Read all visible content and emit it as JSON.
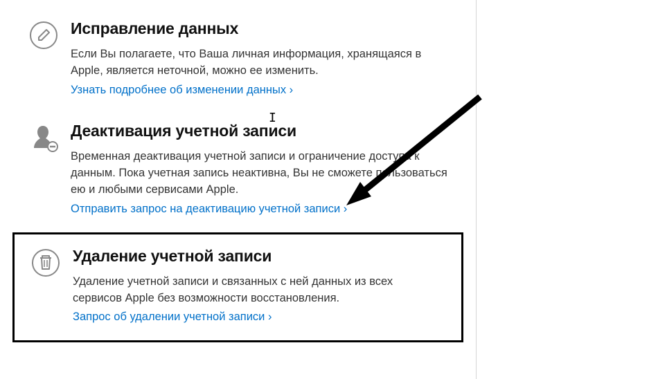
{
  "sections": {
    "correct": {
      "title": "Исправление данных",
      "desc": "Если Вы полагаете, что Ваша личная информация, хранящаяся в Apple, является неточной, можно ее изменить.",
      "link": "Узнать подробнее об изменении данных"
    },
    "deactivate": {
      "title": "Деактивация учетной записи",
      "desc": "Временная деактивация учетной записи и ограничение доступа к данным. Пока учетная запись неактивна, Вы не сможете пользоваться ею и любыми сервисами Apple.",
      "link": "Отправить запрос на деактивацию учетной записи"
    },
    "delete": {
      "title": "Удаление учетной записи",
      "desc": "Удаление учетной записи и связанных с ней данных из всех сервисов Apple без возможности восстановления.",
      "link": "Запрос об удалении учетной записи"
    }
  }
}
